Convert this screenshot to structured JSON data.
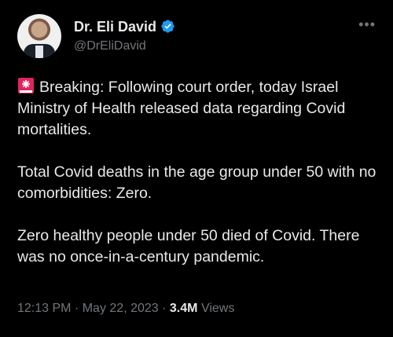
{
  "author": {
    "display_name": "Dr. Eli David",
    "handle": "@DrEliDavid",
    "verified": true
  },
  "tweet": {
    "paragraphs": [
      "Breaking: Following court order, today Israel Ministry of Health released data regarding Covid mortalities.",
      "Total Covid deaths in the age group under 50 with no comorbidities: Zero.",
      "Zero healthy people under 50 died of Covid. There was no once-in-a-century pandemic."
    ],
    "emoji": "siren-emoji"
  },
  "meta": {
    "time": "12:13 PM",
    "separator": "·",
    "date": "May 22, 2023",
    "views_count": "3.4M",
    "views_label": "Views"
  },
  "icons": {
    "verified": "verified-badge-icon",
    "more": "more-options-icon"
  },
  "colors": {
    "background": "#000000",
    "text": "#e7e9ea",
    "secondary_text": "#71767b",
    "verified_blue": "#1d9bf0",
    "siren_red": "#e0245e"
  }
}
